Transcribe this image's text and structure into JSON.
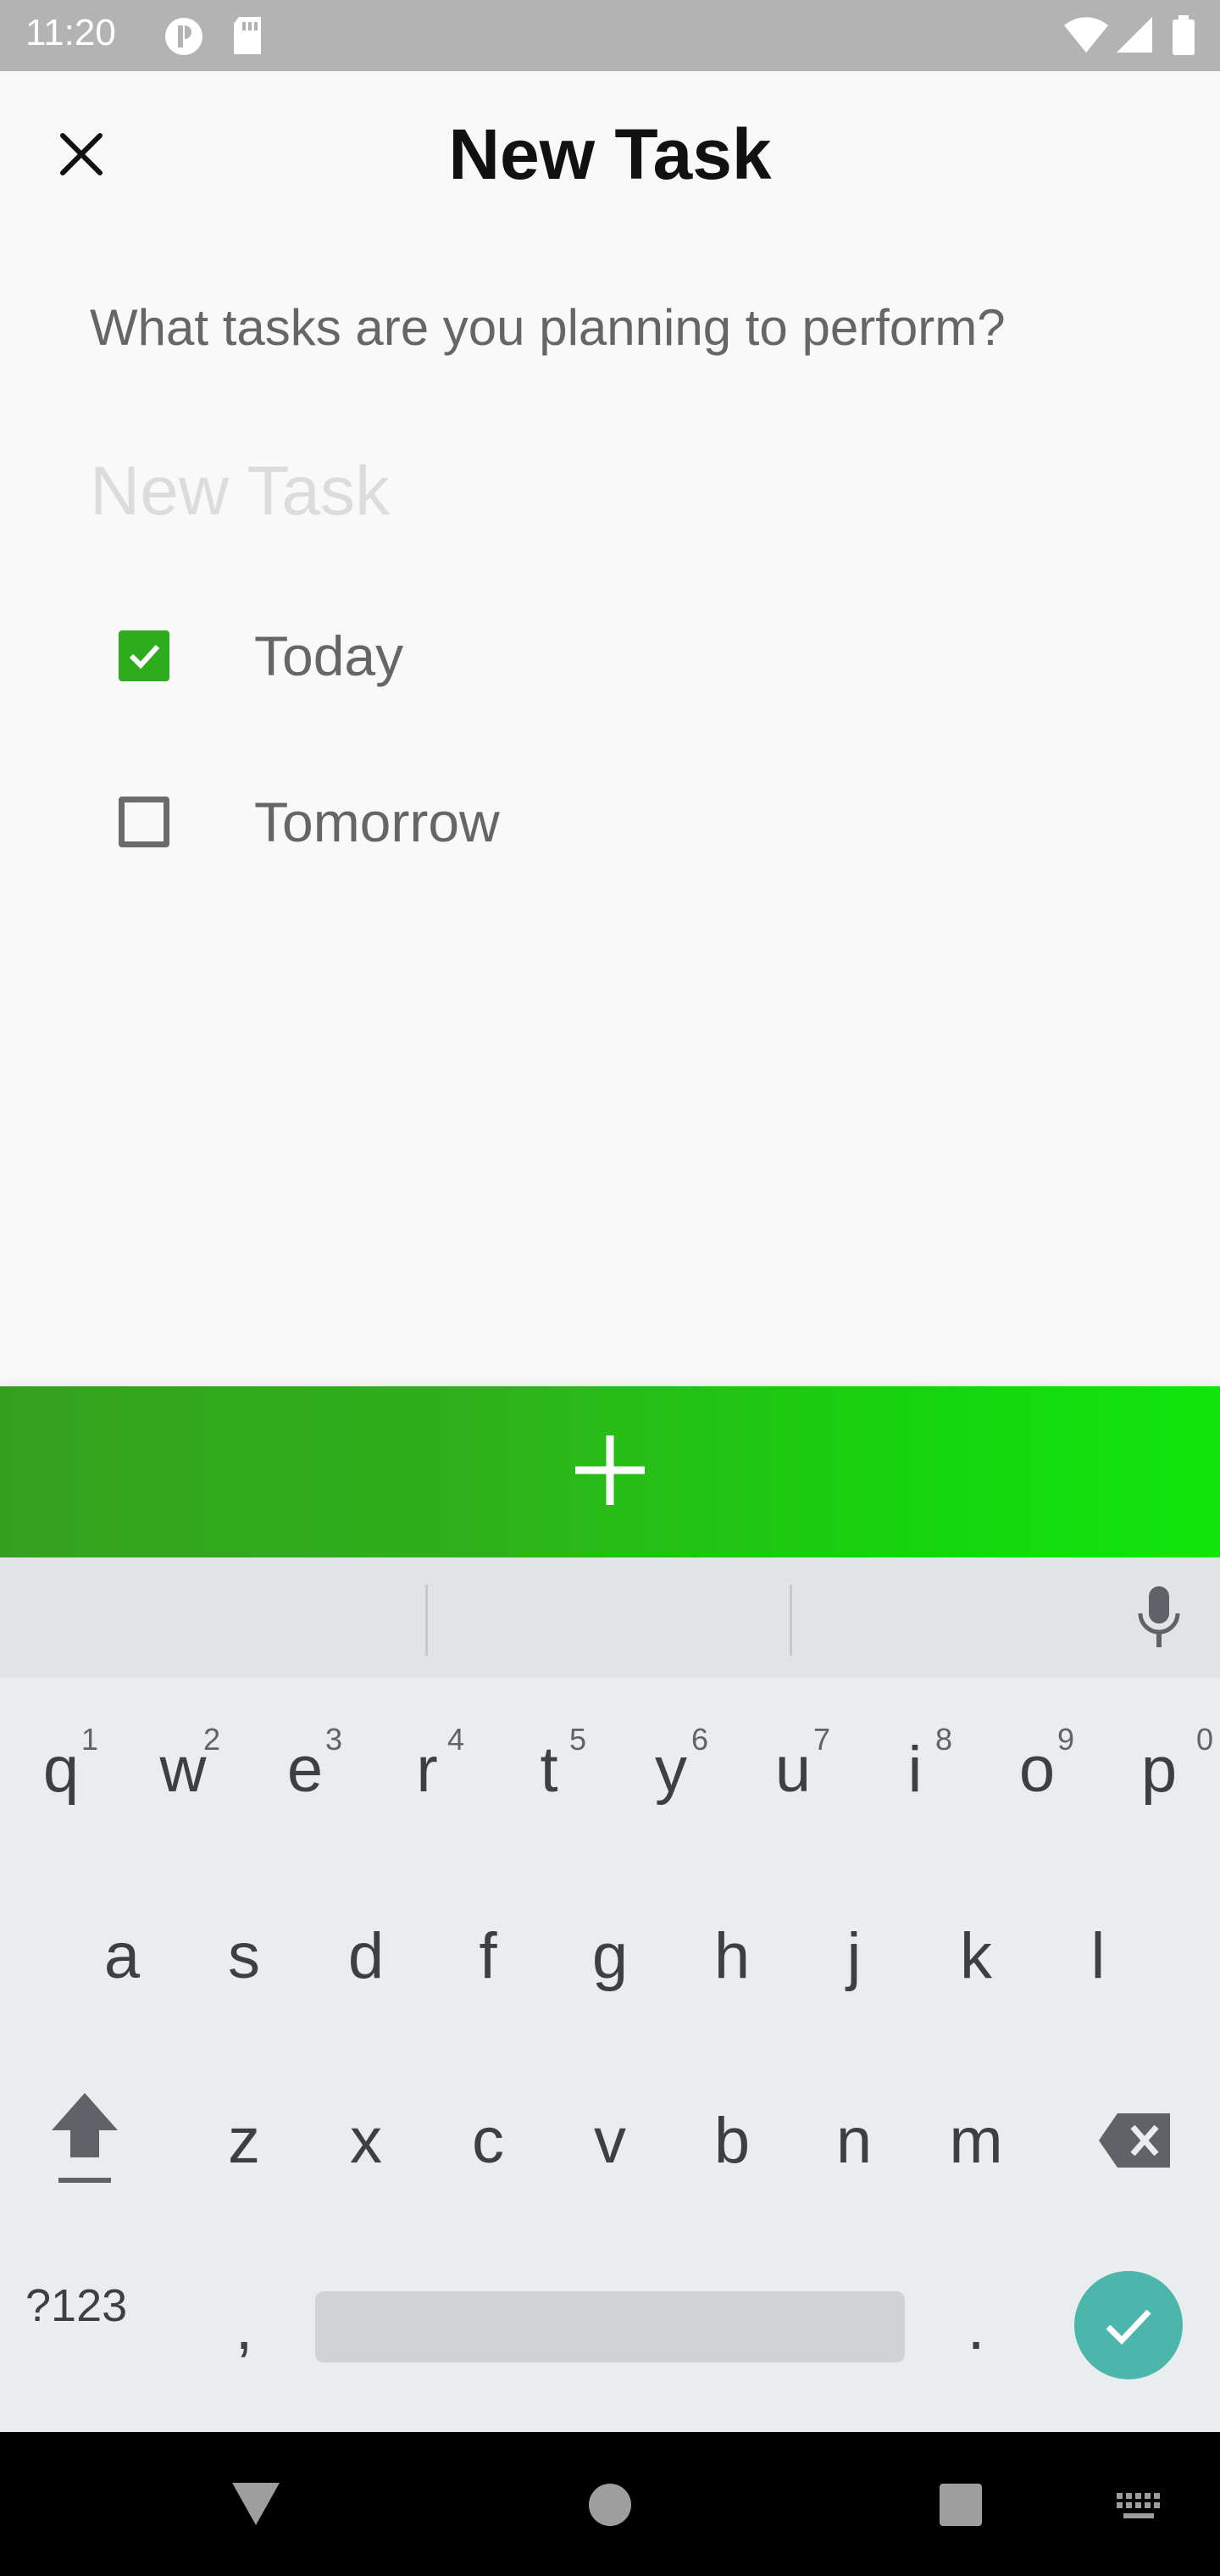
{
  "status_bar": {
    "time": "11:20"
  },
  "header": {
    "title": "New Task"
  },
  "form": {
    "prompt": "What tasks are you planning to perform?",
    "task_placeholder": "New Task",
    "task_value": ""
  },
  "options": [
    {
      "label": "Today",
      "checked": true
    },
    {
      "label": "Tomorrow",
      "checked": false
    }
  ],
  "colors": {
    "accent_green": "#2eac1e",
    "add_bar_start": "#35a01f",
    "add_bar_end": "#10e60b",
    "enter_key": "#4db6ac"
  },
  "icons": {
    "close": "close-icon",
    "add": "plus-icon",
    "mic": "mic-icon",
    "shift": "shift-icon",
    "backspace": "backspace-icon",
    "enter": "check-icon"
  },
  "keyboard": {
    "row1": [
      {
        "key": "q",
        "hint": "1"
      },
      {
        "key": "w",
        "hint": "2"
      },
      {
        "key": "e",
        "hint": "3"
      },
      {
        "key": "r",
        "hint": "4"
      },
      {
        "key": "t",
        "hint": "5"
      },
      {
        "key": "y",
        "hint": "6"
      },
      {
        "key": "u",
        "hint": "7"
      },
      {
        "key": "i",
        "hint": "8"
      },
      {
        "key": "o",
        "hint": "9"
      },
      {
        "key": "p",
        "hint": "0"
      }
    ],
    "row2": [
      "a",
      "s",
      "d",
      "f",
      "g",
      "h",
      "j",
      "k",
      "l"
    ],
    "row3": [
      "z",
      "x",
      "c",
      "v",
      "b",
      "n",
      "m"
    ],
    "symbols_label": "?123",
    "comma": ",",
    "period": "."
  }
}
